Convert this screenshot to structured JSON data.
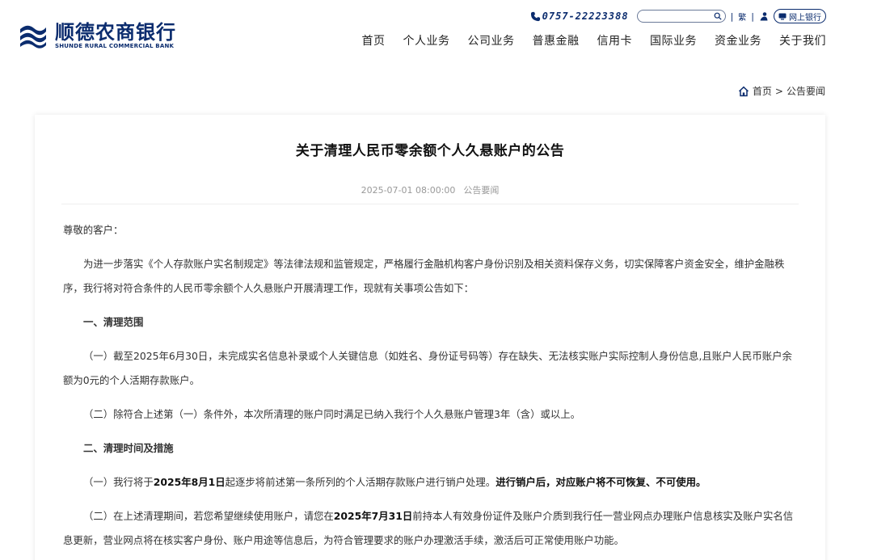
{
  "header": {
    "logo_cn": "顺德农商银行",
    "logo_en": "SHUNDE RURAL COMMERCIAL BANK",
    "phone": "0757-22223388",
    "search_placeholder": "",
    "sep1": "|",
    "traditional": "繁",
    "sep2": "|",
    "ebank_label": "网上银行",
    "nav": [
      "首页",
      "个人业务",
      "公司业务",
      "普惠金融",
      "信用卡",
      "国际业务",
      "资金业务",
      "关于我们"
    ]
  },
  "breadcrumb": {
    "home": "首页",
    "sep": ">",
    "current": "公告要闻"
  },
  "article": {
    "title": "关于清理人民币零余额个人久悬账户的公告",
    "date": "2025-07-01 08:00:00",
    "category": "公告要闻",
    "greeting": "尊敬的客户：",
    "intro": "为进一步落实《个人存款账户实名制规定》等法律法规和监管规定，严格履行金融机构客户身份识别及相关资料保存义务，切实保障客户资金安全，维护金融秩序，我行将对符合条件的人民币零余额个人久悬账户开展清理工作，现就有关事项公告如下：",
    "section1_title": "一、清理范围",
    "s1_p1": "（一）截至2025年6月30日，未完成实名信息补录或个人关键信息（如姓名、身份证号码等）存在缺失、无法核实账户实际控制人身份信息,且账户人民币账户余额为0元的个人活期存款账户。",
    "s1_p2": "（二）除符合上述第（一）条件外，本次所清理的账户同时满足已纳入我行个人久悬账户管理3年（含）或以上。",
    "section2_title": "二、清理时间及措施",
    "s2_p1_a": "（一）我行将于",
    "s2_p1_b": "2025年8月1日",
    "s2_p1_c": "起逐步将前述第一条所列的个人活期存款账户进行销户处理。",
    "s2_p1_d": "进行销户后，对应账户将不可恢复、不可使用。",
    "s2_p2_a": "（二）在上述清理期间，若您希望继续使用账户，请您在",
    "s2_p2_b": "2025年7月31日",
    "s2_p2_c": "前持本人有效身份证件及账户介质到我行任一营业网点办理账户信息核实及账户实名信息更新，营业网点将在核实客户身份、账户用途等信息后，为符合管理要求的账户办理激活手续，激活后可正常使用账户功能。"
  },
  "colors": {
    "brand": "#0b2c6e",
    "meta": "#999999",
    "body_text": "#333333"
  }
}
